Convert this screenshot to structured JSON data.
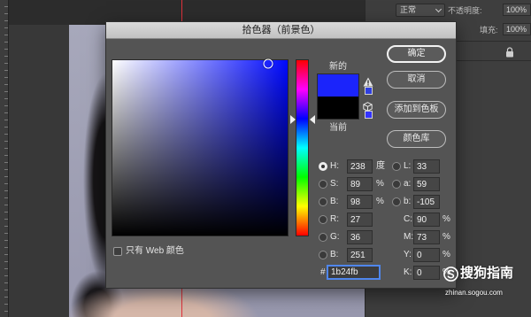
{
  "workspace": {
    "guide_color": "#e0323c"
  },
  "layers_panel": {
    "blend_mode": "正常",
    "opacity_label": "不透明度:",
    "opacity_value": "100%",
    "fill_label": "填充:",
    "fill_value": "100%"
  },
  "dialog": {
    "title": "拾色器（前景色）"
  },
  "color_field": {
    "hue_color": "#0009ff"
  },
  "swatches": {
    "new_label": "新的",
    "current_label": "当前",
    "new_color": "#1b24fb",
    "current_color": "#000000",
    "gamut_color": "#2f3fe0",
    "web_safe_color": "#3333ff"
  },
  "buttons": {
    "ok": "确定",
    "cancel": "取消",
    "add_to_swatches": "添加到色板",
    "color_libraries": "颜色库"
  },
  "fields": {
    "hsb": [
      {
        "label": "H:",
        "value": "238",
        "unit": "度",
        "selected": true
      },
      {
        "label": "S:",
        "value": "89",
        "unit": "%",
        "selected": false
      },
      {
        "label": "B:",
        "value": "98",
        "unit": "%",
        "selected": false
      }
    ],
    "rgb": [
      {
        "label": "R:",
        "value": "27",
        "selected": false
      },
      {
        "label": "G:",
        "value": "36",
        "selected": false
      },
      {
        "label": "B:",
        "value": "251",
        "selected": false
      }
    ],
    "lab": [
      {
        "label": "L:",
        "value": "33",
        "selected": false
      },
      {
        "label": "a:",
        "value": "59",
        "selected": false
      },
      {
        "label": "b:",
        "value": "-105",
        "selected": false
      }
    ],
    "cmyk": [
      {
        "label": "C:",
        "value": "90",
        "unit": "%"
      },
      {
        "label": "M:",
        "value": "73",
        "unit": "%"
      },
      {
        "label": "Y:",
        "value": "0",
        "unit": "%"
      },
      {
        "label": "K:",
        "value": "0",
        "unit": "%"
      }
    ],
    "hex": {
      "label": "#",
      "value": "1b24fb"
    }
  },
  "web_only": {
    "label": "只有 Web 颜色",
    "checked": false
  },
  "watermark": {
    "brand": "搜狗指南",
    "url": "zhinan.sogou.com"
  }
}
